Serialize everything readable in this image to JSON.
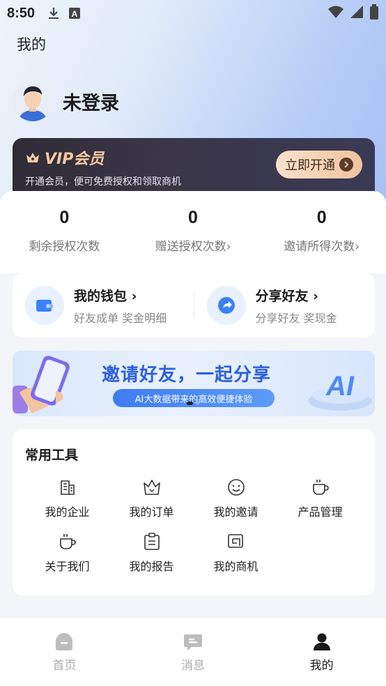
{
  "status_bar": {
    "time": "8:50"
  },
  "page": {
    "title": "我的"
  },
  "profile": {
    "name": "未登录"
  },
  "vip": {
    "title": "VIP会员",
    "subtitle": "开通会员，便可免费授权和领取商机",
    "button_label": "立即开通"
  },
  "stats": [
    {
      "value": "0",
      "label": "剩余授权次数"
    },
    {
      "value": "0",
      "label": "赠送授权次数›"
    },
    {
      "value": "0",
      "label": "邀请所得次数›"
    }
  ],
  "wallet": {
    "title": "我的钱包 ›",
    "subtitle": "好友成单 奖金明细"
  },
  "share": {
    "title": "分享好友 ›",
    "subtitle": "分享好友 奖现金"
  },
  "banner": {
    "title": "邀请好友，一起分享",
    "subtitle": "AI大数据带来的高效便捷体验",
    "badge": "AI"
  },
  "tools": {
    "title": "常用工具",
    "items": [
      {
        "label": "我的企业",
        "icon": "building-icon"
      },
      {
        "label": "我的订单",
        "icon": "crown-outline-icon"
      },
      {
        "label": "我的邀请",
        "icon": "smile-icon"
      },
      {
        "label": "产品管理",
        "icon": "cup-icon"
      },
      {
        "label": "关于我们",
        "icon": "cup-icon"
      },
      {
        "label": "我的报告",
        "icon": "clipboard-icon"
      },
      {
        "label": "我的商机",
        "icon": "frames-icon"
      }
    ]
  },
  "tabbar": {
    "items": [
      {
        "label": "首页",
        "icon": "home-icon",
        "active": false
      },
      {
        "label": "消息",
        "icon": "message-icon",
        "active": false
      },
      {
        "label": "我的",
        "icon": "user-icon",
        "active": true
      }
    ]
  },
  "colors": {
    "accent_blue": "#2f5fe0",
    "vip_gold": "#f6c9a1",
    "vip_dark": "#2f2b36",
    "icon_blue": "#3b82f6"
  }
}
